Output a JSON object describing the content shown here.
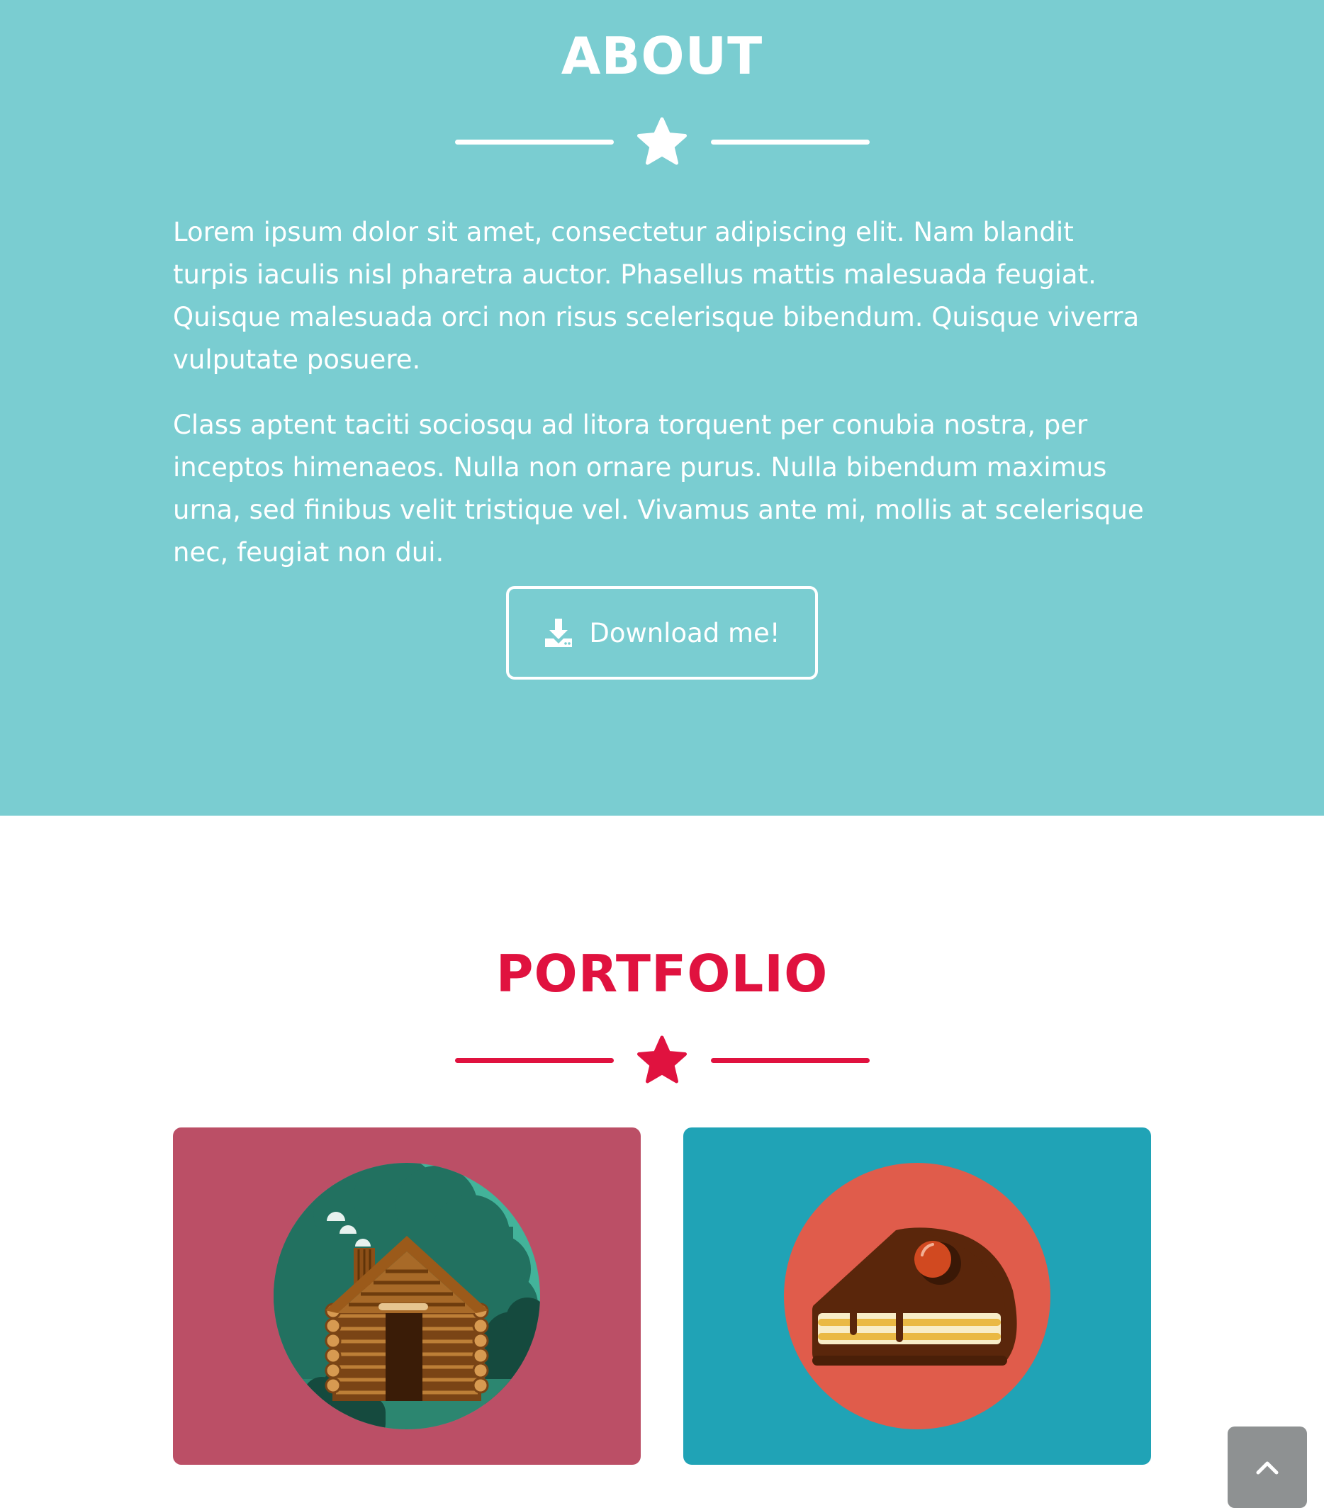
{
  "about": {
    "title": "ABOUT",
    "paragraphs": [
      "Lorem ipsum dolor sit amet, consectetur adipiscing elit. Nam blandit turpis iaculis nisl pharetra auctor. Phasellus mattis malesuada feugiat. Quisque malesuada orci non risus scelerisque bibendum. Quisque viverra vulputate posuere.",
      "Class aptent taciti sociosqu ad litora torquent per conubia nostra, per inceptos himenaeos. Nulla non ornare purus. Nulla bibendum maximus urna, sed finibus velit tristique vel. Vivamus ante mi, mollis at scelerisque nec, feugiat non dui."
    ],
    "download_label": "Download me!",
    "download_icon": "download-icon",
    "divider_icon": "star-icon",
    "background_color": "#7acdd1"
  },
  "portfolio": {
    "title": "PORTFOLIO",
    "title_color": "#e0123f",
    "divider_icon": "star-icon",
    "items": [
      {
        "name": "cabin",
        "icon": "log-cabin-illustration",
        "background_color": "#bb4f66"
      },
      {
        "name": "cake",
        "icon": "cake-slice-illustration",
        "background_color": "#20a3b6"
      }
    ]
  },
  "scroll_top": {
    "icon": "chevron-up-icon",
    "color": "#8e9192"
  }
}
